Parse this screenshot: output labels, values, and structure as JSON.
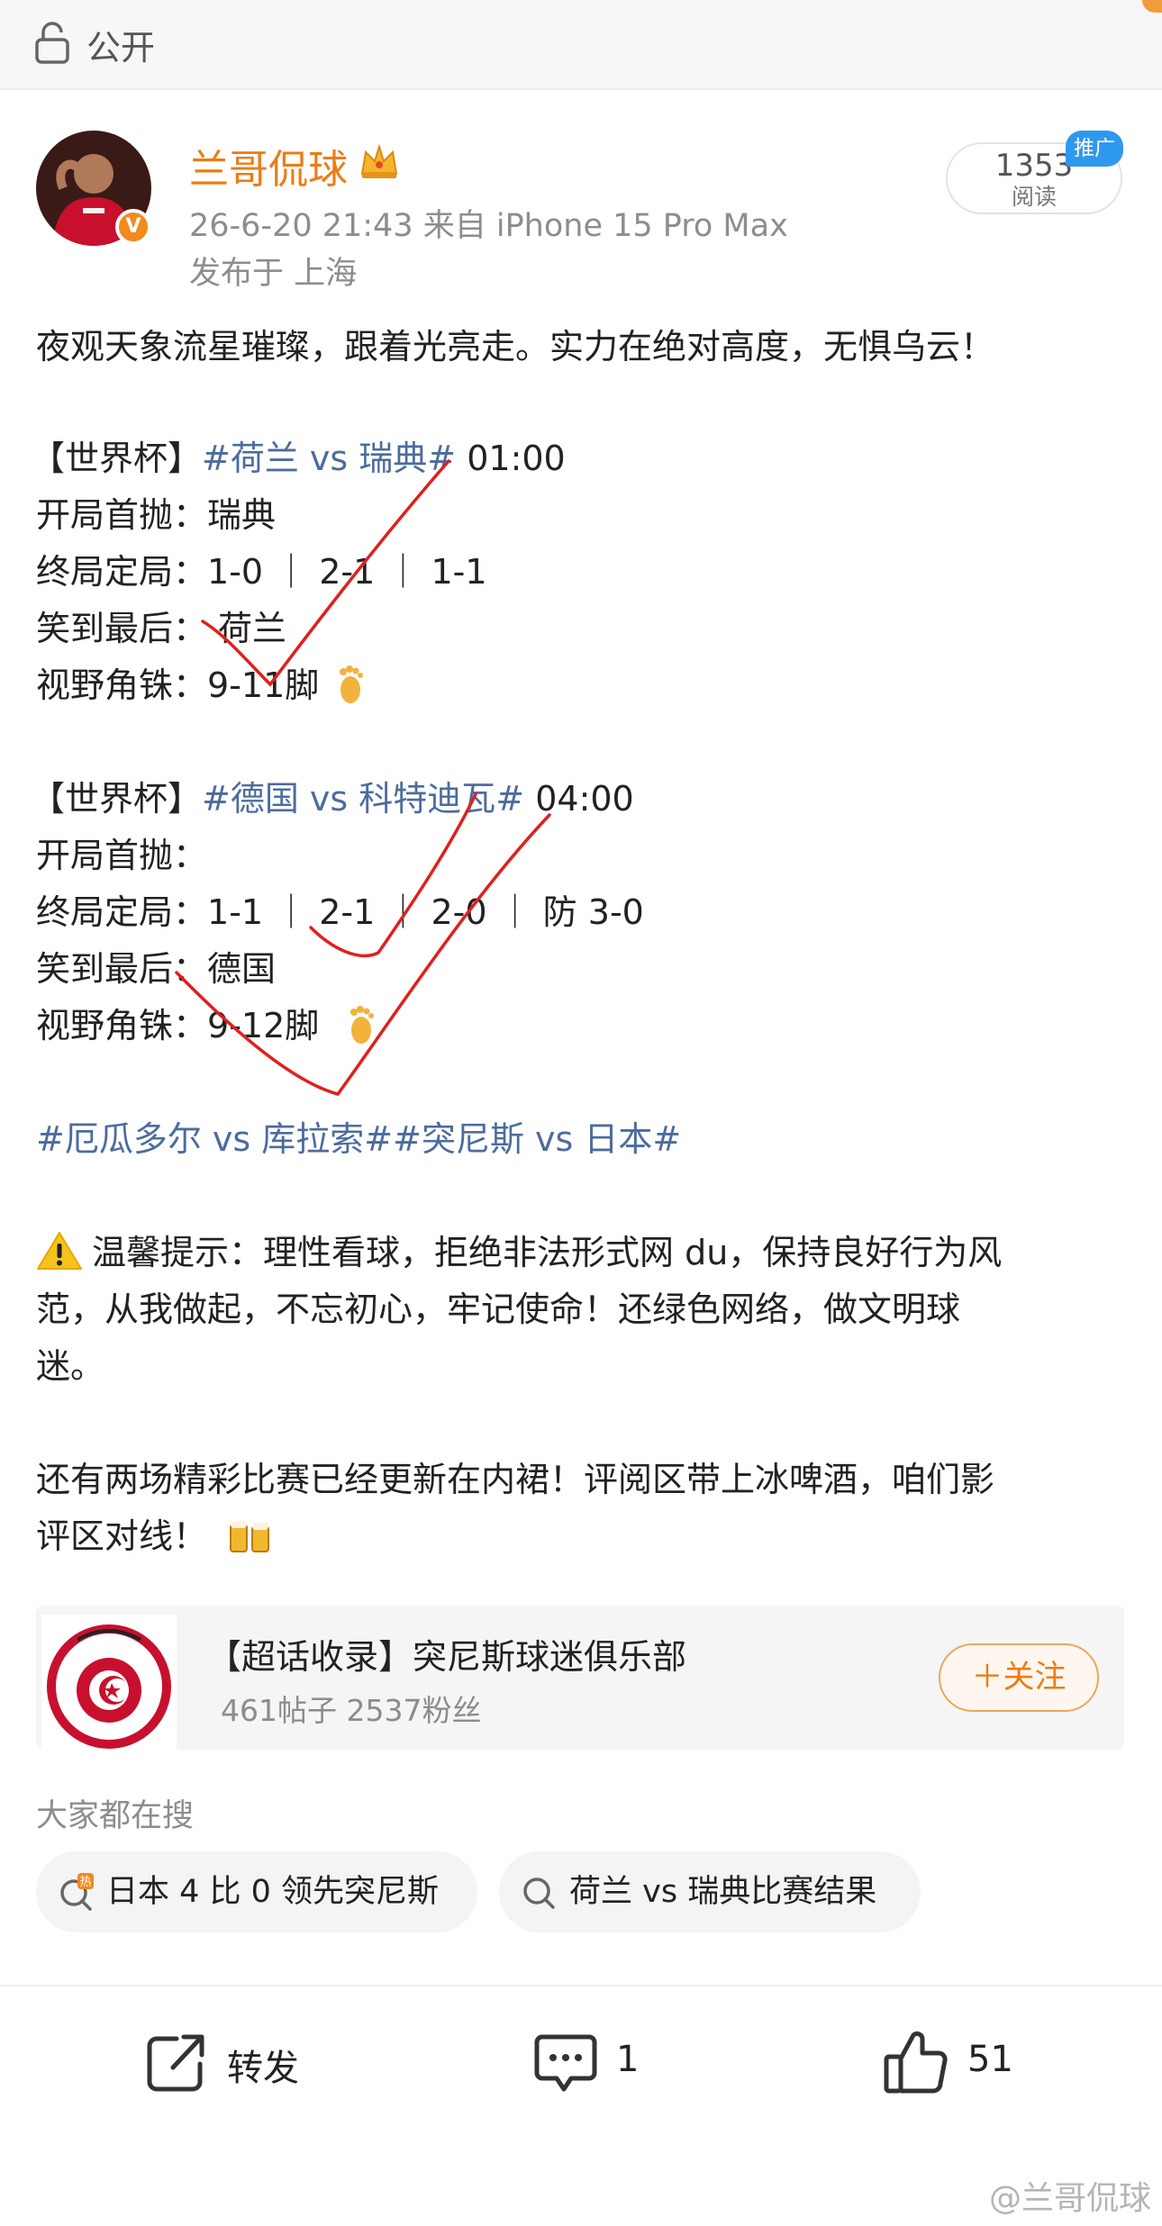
{
  "topbar": {
    "visibility": "公开",
    "icon": "lock-icon"
  },
  "author": {
    "name": "兰哥侃球",
    "badge": "crown-icon",
    "verified": "V",
    "time_source": "26-6-20 21:43  来自 iPhone 15 Pro Max",
    "location": "发布于 上海"
  },
  "stats": {
    "reads": "1353",
    "reads_label": "阅读",
    "promo": "推广"
  },
  "post": {
    "intro": "夜观天象流星璀璨，跟着光亮走。实力在绝对高度，无惧乌云！",
    "match1": {
      "prefix": "【世界杯】",
      "tag": "#荷兰 vs 瑞典#",
      "time": " 01:00",
      "kickoff_label": "开局首抛：",
      "kickoff": "瑞典",
      "final_label": "终局定局：",
      "final": "1-0 ｜ 2-1 ｜ 1-1",
      "last_label": "笑到最后：",
      "last": "荷兰",
      "corner_label": "视野角铢：",
      "corner": "9-11脚",
      "emoji": "foot-icon"
    },
    "match2": {
      "prefix": "【世界杯】",
      "tag": "#德国 vs 科特迪瓦#",
      "time": " 04:00",
      "kickoff_label": "开局首抛：",
      "kickoff": "",
      "final_label": "终局定局：",
      "final": "1-1 ｜ 2-1 ｜ 2-0 ｜ 防 3-0",
      "last_label": "笑到最后：",
      "last": "德国",
      "corner_label": "视野角铢：",
      "corner": "9-12脚",
      "emoji": "foot-icon"
    },
    "tags_line": "#厄瓜多尔 vs 库拉索##突尼斯 vs 日本#",
    "warning_line1": "温馨提示：理性看球，拒绝非法形式网 du，保持良好行为风",
    "warning_line2": "范，从我做起，不忘初心，牢记使命！还绿色网络，做文明球",
    "warning_line3": "迷。",
    "closing_line1": "还有两场精彩比赛已经更新在内裙！评阅区带上冰啤酒，咱们影",
    "closing_line2": "评区对线！"
  },
  "topic_card": {
    "title": "【超话收录】突尼斯球迷俱乐部",
    "stats": "461帖子 2537粉丝",
    "follow": "＋关注"
  },
  "search": {
    "heading": "大家都在搜",
    "items": [
      "日本 4 比 0 领先突尼斯",
      "荷兰 vs 瑞典比赛结果"
    ]
  },
  "actions": {
    "repost": "转发",
    "comments": "1",
    "likes": "51"
  },
  "watermark": "@兰哥侃球",
  "colors": {
    "accent": "#ea7d16",
    "tag": "#4d6c9d",
    "handmark": "#e0201c",
    "promo": "#2e98ef"
  }
}
